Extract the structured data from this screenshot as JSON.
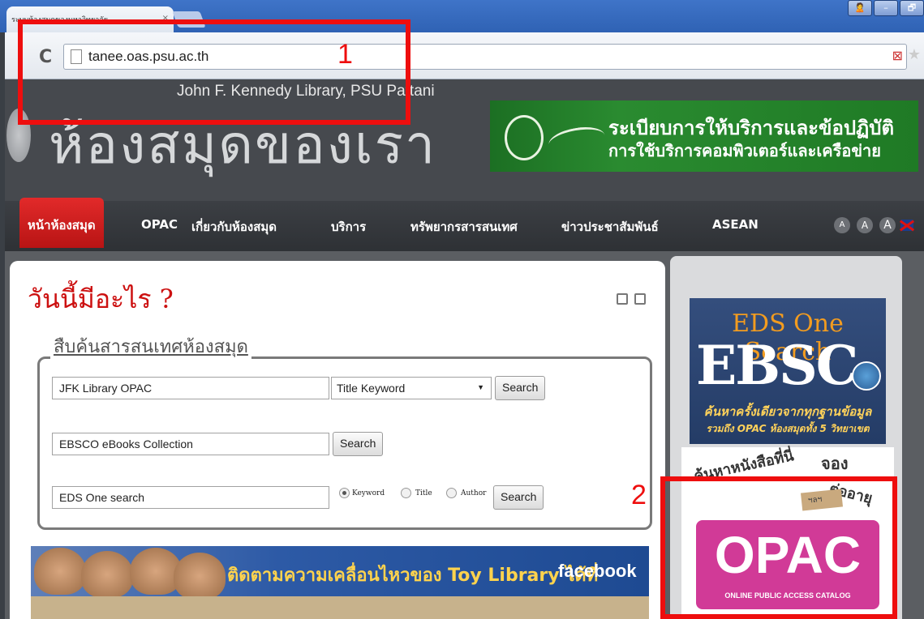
{
  "browser": {
    "tab_title": "ระบบห้องสมุดของมหาวิทยาลัย",
    "tab_close": "×",
    "url": "tanee.oas.psu.ac.th",
    "window_buttons": [
      "🙎",
      "–",
      "🗗"
    ]
  },
  "header": {
    "subtitle": "John F. Kennedy Library, PSU Pattani",
    "title": "ห้องสมุดของเรา",
    "banner_line1": "ระเบียบการให้บริการและข้อปฏิบัติ",
    "banner_line2": "การใช้บริการคอมพิวเตอร์และเครือข่าย"
  },
  "nav": {
    "items": [
      "หน้าห้องสมุด",
      "OPAC",
      "เกี่ยวกับห้องสมุด",
      "บริการ",
      "ทรัพยากรสารสนเทศ",
      "ข่าวประชาสัมพันธ์",
      "ASEAN"
    ],
    "active_index": 0,
    "font_sizes": [
      "A",
      "A",
      "A"
    ]
  },
  "main": {
    "heading": "วันนี้มีอะไร ?",
    "search_title": "สืบค้นสารสนเทศห้องสมุด",
    "rows": [
      {
        "input": "JFK Library OPAC",
        "select": "Title Keyword",
        "button": "Search"
      },
      {
        "input": "EBSCO eBooks Collection",
        "button": "Search"
      },
      {
        "input": "EDS One search",
        "radios": [
          "Keyword",
          "Title",
          "Author"
        ],
        "button": "Search"
      }
    ],
    "fb_banner_text": "ติดตามความเคลื่อนไหวของ Toy Library ได้ที่",
    "fb_brand": "facebook"
  },
  "sidebar": {
    "eds_title": "EDS One Search",
    "eds_big": "EBSC",
    "eds_line1": "ค้นหาครั้งเดียวจากทุกฐานข้อมูล",
    "eds_line2": "รวมถึง OPAC ห้องสมุดทั้ง 5 วิทยาเขต",
    "opac_handwriting": "ค้นหาหนังสือที่นี่",
    "opac_book": "จอง",
    "opac_renew": "ต่ออายุ",
    "opac_tape": "ฯลฯ",
    "opac_big": "OPAC",
    "opac_small": "ONLINE PUBLIC ACCESS CATALOG"
  },
  "callouts": [
    {
      "number": "1",
      "color": "#ee0e0e"
    },
    {
      "number": "2",
      "color": "#ee0e0e"
    }
  ]
}
